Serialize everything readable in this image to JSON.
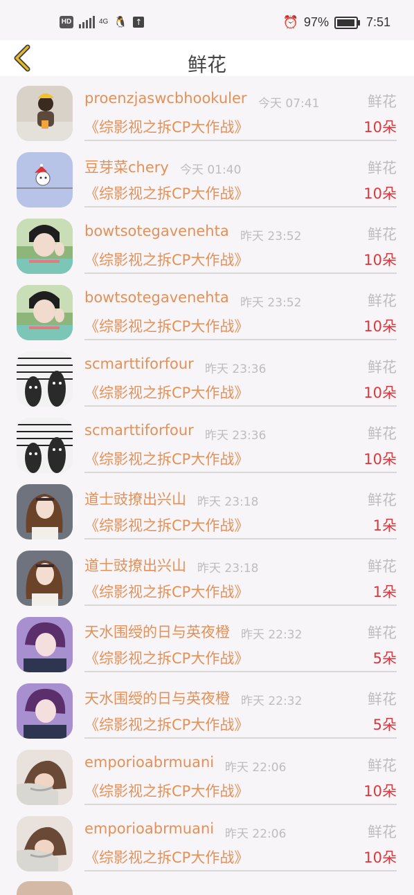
{
  "status_bar": {
    "left_badge": "HD",
    "network": "4G",
    "battery": "97%",
    "battery_level": 0.97,
    "time": "7:51"
  },
  "header": {
    "title": "鲜花",
    "back_icon": "chevron-left-icon",
    "accent": "#e3b92e"
  },
  "colors": {
    "name": "#e2915a",
    "count": "#d8383f",
    "muted": "#bdbdbd"
  },
  "rows": [
    {
      "name": "proenzjaswcbhookuler",
      "time": "今天 07:41",
      "type": "鲜花",
      "show": "《综影视之拆CP大作战》",
      "count": "10朵",
      "avatar": "avatar-1"
    },
    {
      "name": "豆芽菜chery",
      "time": "今天 01:40",
      "type": "鲜花",
      "show": "《综影视之拆CP大作战》",
      "count": "10朵",
      "avatar": "avatar-2"
    },
    {
      "name": "bowtsotegavenehta",
      "time": "昨天 23:52",
      "type": "鲜花",
      "show": "《综影视之拆CP大作战》",
      "count": "10朵",
      "avatar": "avatar-3"
    },
    {
      "name": "bowtsotegavenehta",
      "time": "昨天 23:52",
      "type": "鲜花",
      "show": "《综影视之拆CP大作战》",
      "count": "10朵",
      "avatar": "avatar-3"
    },
    {
      "name": "scmarttiforfour",
      "time": "昨天 23:36",
      "type": "鲜花",
      "show": "《综影视之拆CP大作战》",
      "count": "10朵",
      "avatar": "avatar-4"
    },
    {
      "name": "scmarttiforfour",
      "time": "昨天 23:36",
      "type": "鲜花",
      "show": "《综影视之拆CP大作战》",
      "count": "10朵",
      "avatar": "avatar-4"
    },
    {
      "name": "道士豉撩出兴山",
      "time": "昨天 23:18",
      "type": "鲜花",
      "show": "《综影视之拆CP大作战》",
      "count": "1朵",
      "avatar": "avatar-5"
    },
    {
      "name": "道士豉撩出兴山",
      "time": "昨天 23:18",
      "type": "鲜花",
      "show": "《综影视之拆CP大作战》",
      "count": "1朵",
      "avatar": "avatar-5"
    },
    {
      "name": "天水围绶的日与英夜橙",
      "time": "昨天 22:32",
      "type": "鲜花",
      "show": "《综影视之拆CP大作战》",
      "count": "5朵",
      "avatar": "avatar-6"
    },
    {
      "name": "天水围绶的日与英夜橙",
      "time": "昨天 22:32",
      "type": "鲜花",
      "show": "《综影视之拆CP大作战》",
      "count": "5朵",
      "avatar": "avatar-6"
    },
    {
      "name": "emporioabrmuani",
      "time": "昨天 22:06",
      "type": "鲜花",
      "show": "《综影视之拆CP大作战》",
      "count": "10朵",
      "avatar": "avatar-7"
    },
    {
      "name": "emporioabrmuani",
      "time": "昨天 22:06",
      "type": "鲜花",
      "show": "《综影视之拆CP大作战》",
      "count": "10朵",
      "avatar": "avatar-7"
    }
  ]
}
